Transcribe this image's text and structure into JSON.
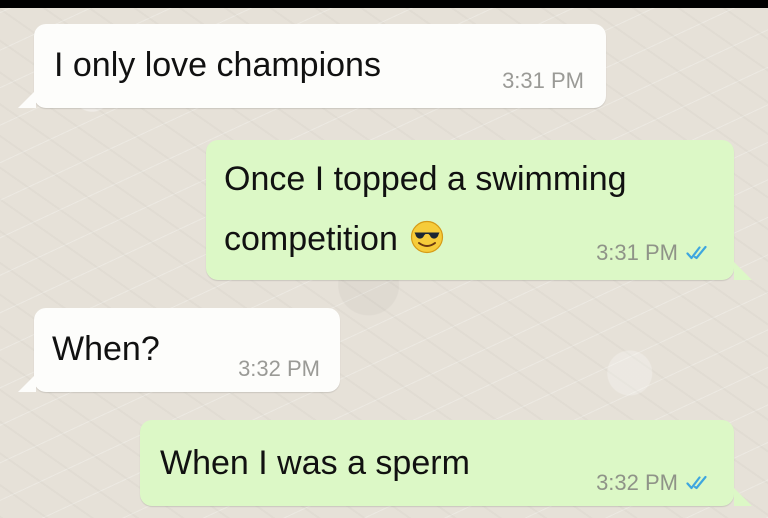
{
  "chat": {
    "messages": [
      {
        "direction": "incoming",
        "text": "I only love champions",
        "time": "3:31 PM"
      },
      {
        "direction": "outgoing",
        "text_line1": "Once I topped a swimming",
        "text_line2": "competition",
        "emoji": "smiling-face-with-sunglasses-emoji",
        "time": "3:31 PM",
        "status": "read-double-check-icon"
      },
      {
        "direction": "incoming",
        "text": "When?",
        "time": "3:32 PM"
      },
      {
        "direction": "outgoing",
        "text": "When I was a sperm",
        "time": "3:32 PM",
        "status": "read-double-check-icon"
      }
    ]
  },
  "colors": {
    "incoming_bubble": "#fdfdfb",
    "outgoing_bubble": "#dcf8c6",
    "read_ticks": "#3ea6df",
    "chat_background": "#e6e1d8"
  }
}
